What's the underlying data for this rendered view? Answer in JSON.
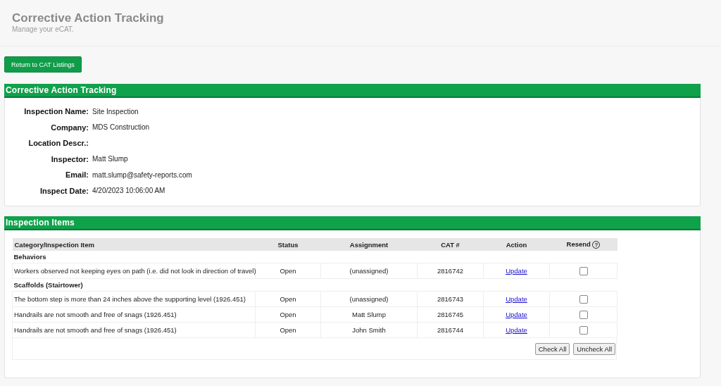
{
  "header": {
    "title": "Corrective Action Tracking",
    "subtitle": "Manage your eCAT."
  },
  "return_button": "Return to CAT Listings",
  "details_section": {
    "title": "Corrective Action Tracking",
    "fields": [
      {
        "label": "Inspection Name:",
        "value": "Site Inspection"
      },
      {
        "label": "Company:",
        "value": "MDS Construction"
      },
      {
        "label": "Location Descr.:"
      },
      {
        "label": "Inspector:",
        "value": "Matt Slump"
      },
      {
        "label": "Email:",
        "value": "matt.slump@safety-reports.com"
      },
      {
        "label": "Inspect Date:",
        "value": "4/20/2023 10:06:00 AM"
      }
    ]
  },
  "items_section": {
    "title": "Inspection Items",
    "columns": [
      "Category/Inspection Item",
      "Status",
      "Assignment",
      "CAT #",
      "Action",
      "Resend"
    ],
    "help_mark": "?",
    "rows": [
      {
        "kind": "category",
        "label": "Behaviors"
      },
      {
        "kind": "item",
        "item": "Workers observed not keeping eyes on path (i.e. did not look in direction of travel)",
        "status": "Open",
        "assignment": "(unassigned)",
        "cat_number": "2816742",
        "action": "Update",
        "checked": false
      },
      {
        "kind": "category",
        "label": "Scaffolds (Stairtower)"
      },
      {
        "kind": "item",
        "item": "The bottom step is more than 24 inches above the supporting level (1926.451)",
        "status": "Open",
        "assignment": "(unassigned)",
        "cat_number": "2816743",
        "action": "Update",
        "checked": false
      },
      {
        "kind": "item",
        "item": "Handrails are not smooth and free of snags (1926.451)",
        "status": "Open",
        "assignment": "Matt Slump",
        "cat_number": "2816745",
        "action": "Update",
        "checked": false
      },
      {
        "kind": "item",
        "item": "Handrails are not smooth and free of snags (1926.451)",
        "status": "Open",
        "assignment": "John Smith",
        "cat_number": "2816744",
        "action": "Update",
        "checked": false
      }
    ],
    "buttons": [
      "Check All",
      "Uncheck All"
    ]
  }
}
